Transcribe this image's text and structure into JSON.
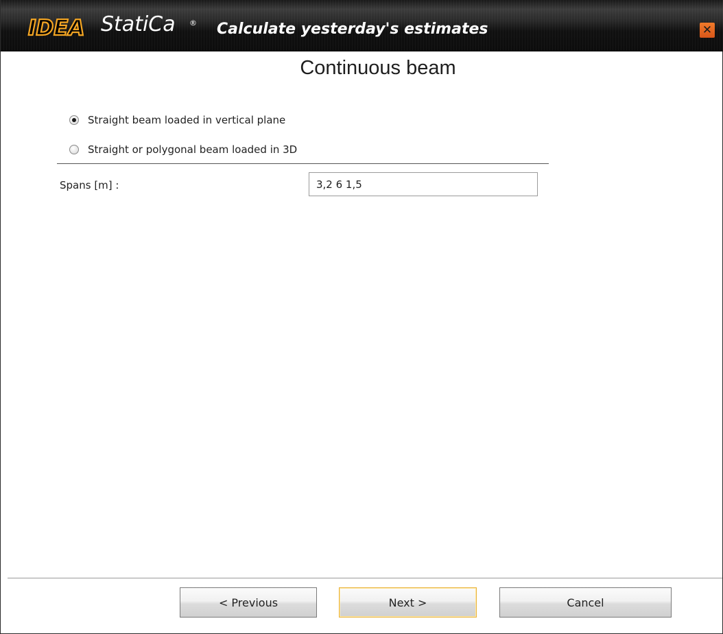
{
  "titlebar": {
    "logo_idea": "IDEA",
    "logo_statica": "StatiCa",
    "logo_reg": "®",
    "tagline": "Calculate yesterday's estimates",
    "close_icon": "close-icon",
    "close_glyph": "✕",
    "accent_color": "#f5a623",
    "close_color": "#e0641f"
  },
  "page": {
    "title": "Continuous beam"
  },
  "beam_type": {
    "options": [
      {
        "label": "Straight beam loaded in vertical plane",
        "selected": true
      },
      {
        "label": "Straight or polygonal beam loaded in 3D",
        "selected": false
      }
    ]
  },
  "spans": {
    "label": "Spans [m] :",
    "value": "3,2 6 1,5"
  },
  "footer": {
    "previous_label": "< Previous",
    "next_label": "Next >",
    "cancel_label": "Cancel"
  }
}
